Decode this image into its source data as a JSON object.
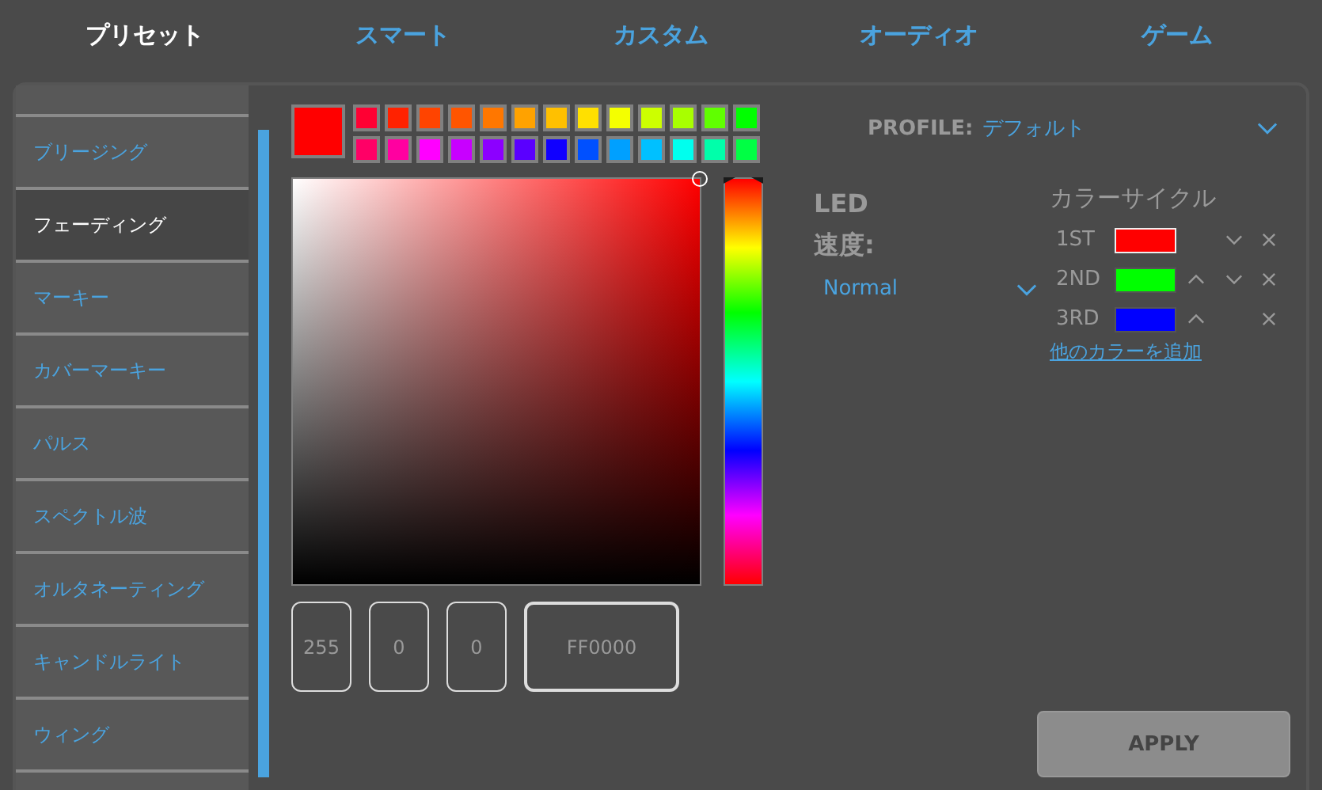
{
  "tabs": [
    {
      "label": "プリセット",
      "selected": true
    },
    {
      "label": "スマート",
      "selected": false
    },
    {
      "label": "カスタム",
      "selected": false
    },
    {
      "label": "オーディオ",
      "selected": false
    },
    {
      "label": "ゲーム",
      "selected": false
    }
  ],
  "effects": [
    {
      "label": "ブリージング",
      "selected": false
    },
    {
      "label": "フェーディング",
      "selected": true
    },
    {
      "label": "マーキー",
      "selected": false
    },
    {
      "label": "カバーマーキー",
      "selected": false
    },
    {
      "label": "パルス",
      "selected": false
    },
    {
      "label": "スペクトル波",
      "selected": false
    },
    {
      "label": "オルタネーティング",
      "selected": false
    },
    {
      "label": "キャンドルライト",
      "selected": false
    },
    {
      "label": "ウィング",
      "selected": false
    }
  ],
  "picker": {
    "current": {
      "color": "#ff0000"
    },
    "hue": {
      "level": 0
    },
    "swatches": [
      {
        "color": "#ff0033"
      },
      {
        "color": "#ff2200"
      },
      {
        "color": "#ff4400"
      },
      {
        "color": "#ff5500"
      },
      {
        "color": "#ff7700"
      },
      {
        "color": "#ffa200"
      },
      {
        "color": "#ffc000"
      },
      {
        "color": "#ffe000"
      },
      {
        "color": "#f4ff00"
      },
      {
        "color": "#ccff00"
      },
      {
        "color": "#a8ff00"
      },
      {
        "color": "#60ff00"
      },
      {
        "color": "#00ff00"
      },
      {
        "color": "#ff0066"
      },
      {
        "color": "#ff00a0"
      },
      {
        "color": "#ff00ff"
      },
      {
        "color": "#c800ff"
      },
      {
        "color": "#8c00ff"
      },
      {
        "color": "#5a00ff"
      },
      {
        "color": "#1000ff"
      },
      {
        "color": "#0050ff"
      },
      {
        "color": "#00a0ff"
      },
      {
        "color": "#00c0ff"
      },
      {
        "color": "#00ffee"
      },
      {
        "color": "#00ffaa"
      },
      {
        "color": "#00ff44"
      }
    ],
    "r": "255",
    "g": "0",
    "b": "0",
    "hex": "FF0000"
  },
  "profile": {
    "label": "PROFILE:",
    "value": "デフォルト"
  },
  "led": {
    "title": "LED",
    "speed_label": "速度:",
    "speed_value": "Normal"
  },
  "color_cycle": {
    "title": "カラーサイクル",
    "items": [
      {
        "label": "1ST",
        "color": "#ff0000",
        "selected": true,
        "up": false,
        "down": true
      },
      {
        "label": "2ND",
        "color": "#00ff00",
        "selected": false,
        "up": true,
        "down": true
      },
      {
        "label": "3RD",
        "color": "#0000ff",
        "selected": false,
        "up": true,
        "down": false
      }
    ],
    "add_link": "他のカラーを追加"
  },
  "apply": "APPLY"
}
